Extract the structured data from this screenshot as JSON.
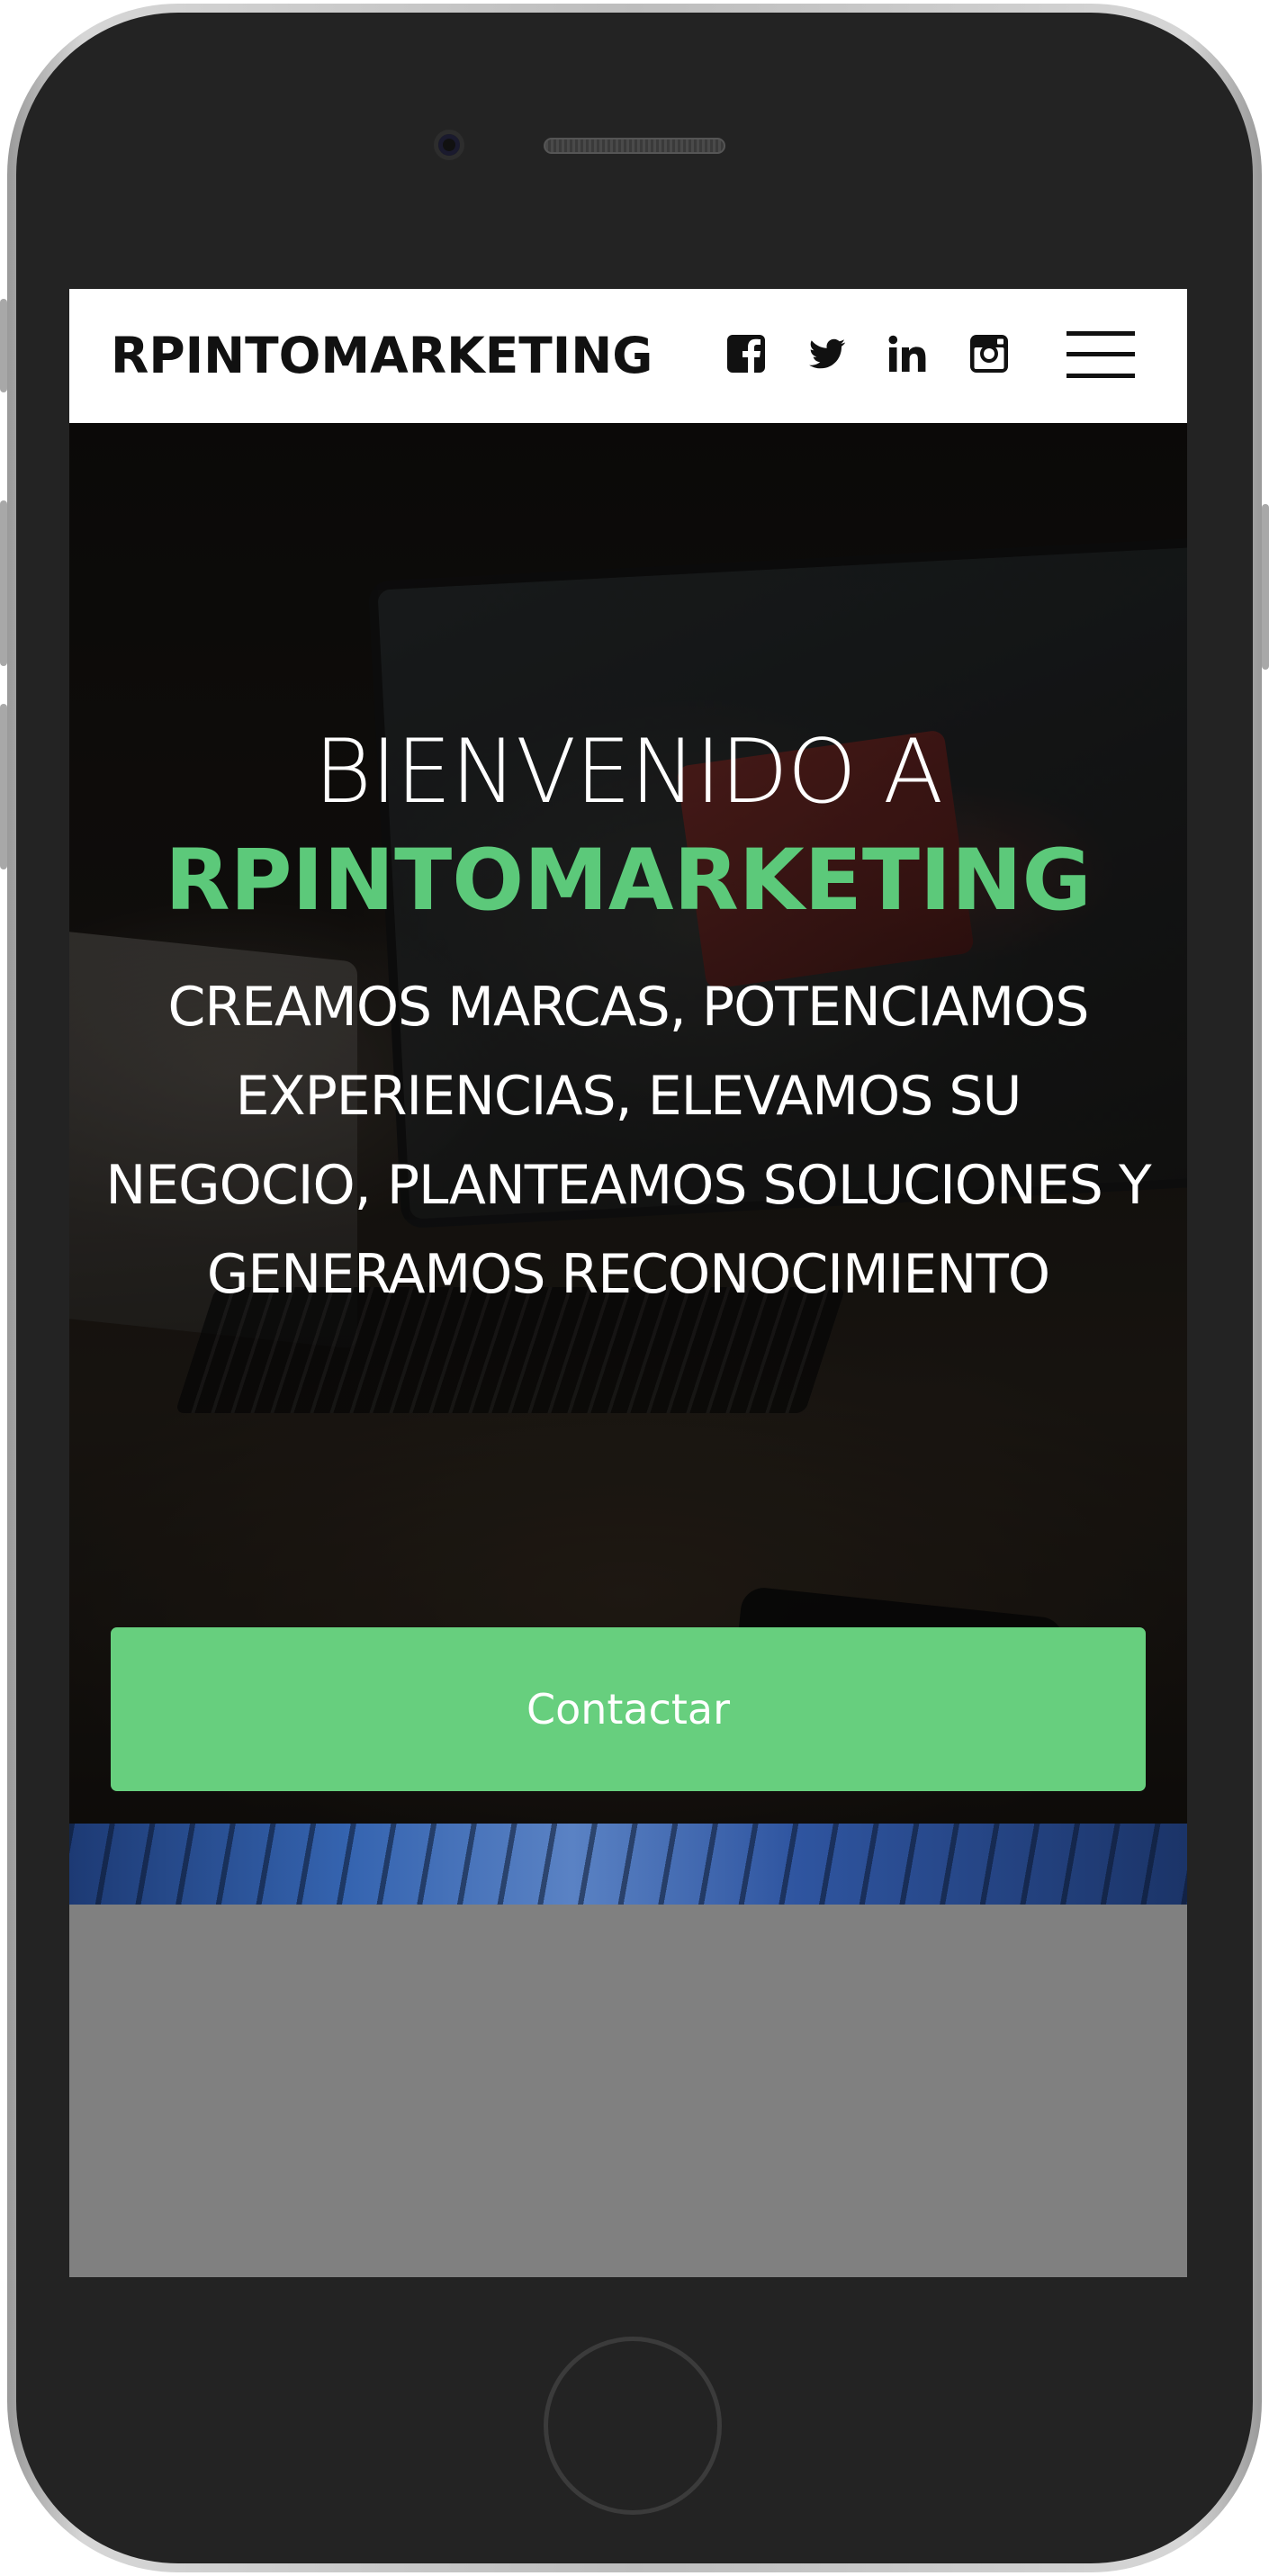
{
  "navbar": {
    "brand": "RPINTOMARKETING",
    "social": [
      {
        "name": "facebook",
        "icon": "facebook-icon"
      },
      {
        "name": "twitter",
        "icon": "twitter-icon"
      },
      {
        "name": "linkedin",
        "icon": "linkedin-icon"
      },
      {
        "name": "instagram",
        "icon": "instagram-icon"
      }
    ],
    "menu_icon": "hamburger-menu-icon"
  },
  "hero": {
    "title_line1": "BIENVENIDO A",
    "title_line2": "RPINTOMARKETING",
    "subtitle": "CREAMOS MARCAS, POTENCIAMOS EXPERIENCIAS, ELEVAMOS SU NEGOCIO, PLANTEAMOS SOLUCIONES Y GENERAMOS RECONOCIMIENTO",
    "cta_label": "Contactar"
  },
  "colors": {
    "accent": "#5cc97a",
    "button": "#67cf7e",
    "navbar_bg": "#ffffff",
    "screen_bg": "#808080",
    "device_frame": "#232323"
  }
}
